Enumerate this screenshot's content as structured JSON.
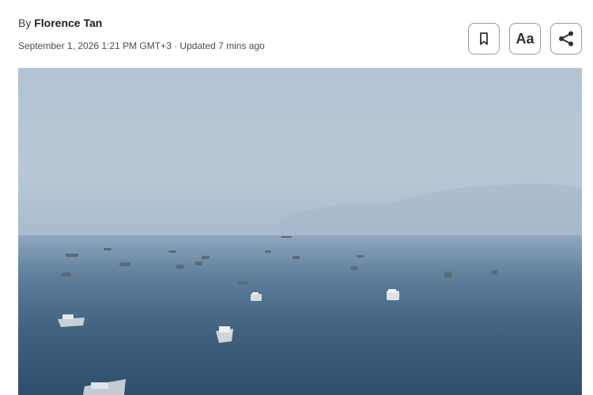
{
  "article": {
    "byline_prefix": "By",
    "author": "Florence Tan",
    "dateline": "September 1, 2026 1:21 PM GMT+3 · Updated 7 mins ago"
  },
  "actions": {
    "bookmark_icon": "bookmark-icon",
    "font_size_label": "Aa",
    "share_icon": "share-icon"
  },
  "image": {
    "subject": "ships anchored on hazy sea",
    "sky_color": "#b8c8d6",
    "sea_color": "#345878"
  }
}
